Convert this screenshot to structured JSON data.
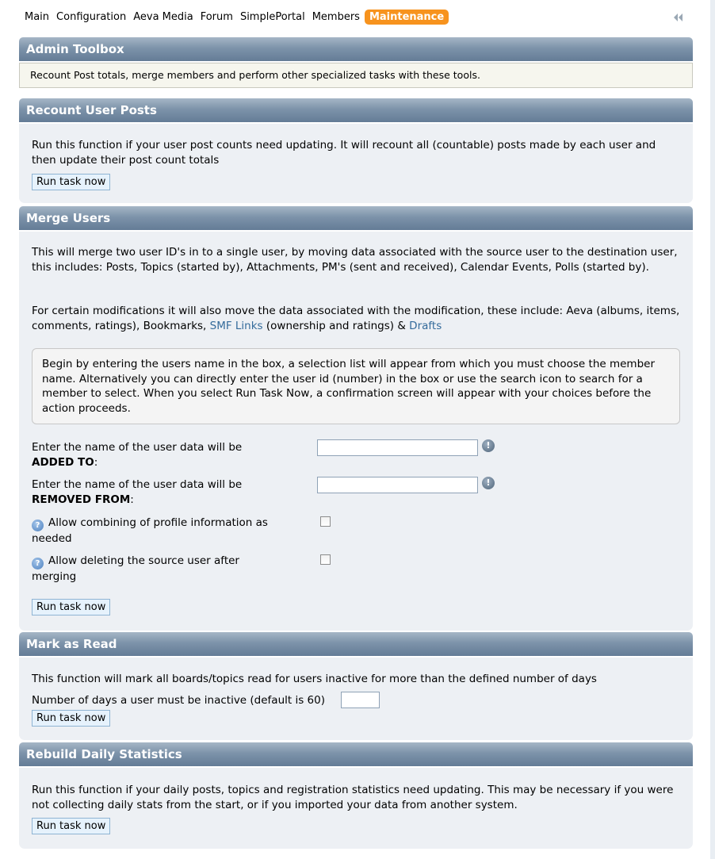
{
  "nav": {
    "items": [
      "Main",
      "Configuration",
      "Aeva Media",
      "Forum",
      "SimplePortal",
      "Members",
      "Maintenance"
    ],
    "active": "Maintenance"
  },
  "admin_toolbox": {
    "title": "Admin Toolbox",
    "description": "Recount Post totals, merge members and perform other specialized tasks with these tools."
  },
  "recount": {
    "title": "Recount User Posts",
    "text": "Run this function if your user post counts need updating. It will recount all (countable) posts made by each user and then update their post count totals",
    "button": "Run task now"
  },
  "merge": {
    "title": "Merge Users",
    "text1": "This will merge two user ID's in to a single user, by moving data associated with the source user to the destination user, this includes: Posts, Topics (started by), Attachments, PM's (sent and received), Calendar Events, Polls (started by).",
    "text2_a": "For certain modifications it will also move the data associated with the modification, these include: Aeva (albums, items, comments, ratings), Bookmarks, ",
    "link1": "SMF Links",
    "text2_b": " (ownership and ratings) & ",
    "link2": "Drafts",
    "note": "Begin by entering the users name in the box, a selection list will appear from which you must choose the member name. Alternatively you can directly enter the user id (number) in the box or use the search icon to search for a member to select. When you select Run Task Now, a confirmation screen will appear with your choices before the action proceeds.",
    "added_label": "Enter the name of the user data will be",
    "added_bold": "ADDED TO",
    "removed_label": "Enter the name of the user data will be",
    "removed_bold": "REMOVED FROM",
    "colon": ":",
    "combine_label": "Allow combining of profile information as needed",
    "delete_label": "Allow deleting the source user after merging",
    "button": "Run task now"
  },
  "mark_read": {
    "title": "Mark as Read",
    "text": "This function will mark all boards/topics read for users inactive for more than the defined number of days",
    "days_label": "Number of days a user must be inactive (default is 60)",
    "days_value": "",
    "button": "Run task now"
  },
  "daily_stats": {
    "title": "Rebuild Daily Statistics",
    "text": "Run this function if your daily posts, topics and registration statistics need updating. This may be necessary if you were not collecting daily stats from the start, or if you imported your data from another system.",
    "button": "Run task now"
  },
  "colors": {
    "active_tab": "#f7931e",
    "header_gradient": "#7d93aa",
    "panel_bg": "#edf0f4",
    "link": "#346b9b"
  }
}
